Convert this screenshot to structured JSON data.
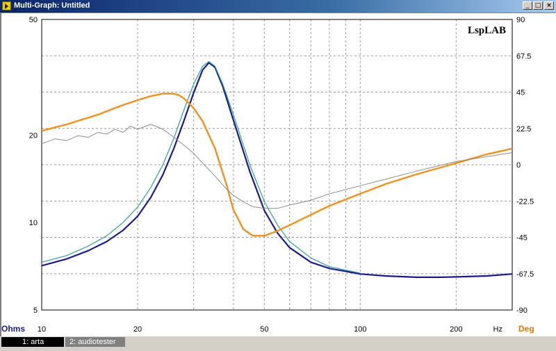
{
  "window": {
    "title": "Multi-Graph: Untitled",
    "buttons": [
      "_",
      "□",
      "×"
    ]
  },
  "watermark": "LspLAB",
  "tabs": [
    {
      "label": "1: arta",
      "active": true
    },
    {
      "label": "2: audiotester",
      "active": false
    }
  ],
  "chart_data": {
    "type": "line",
    "xlabel": "Hz",
    "ylabel_left": "Ohms",
    "ylabel_right": "Deg",
    "x_scale": "log",
    "xlim": [
      10,
      300
    ],
    "ylim_left": [
      5,
      50
    ],
    "y_left_scale": "log",
    "ylim_right": [
      -90,
      90
    ],
    "x_ticks": [
      10,
      20,
      50,
      100,
      200
    ],
    "x_tick_labels": [
      "10",
      "20",
      "50",
      "100",
      "200"
    ],
    "y_left_ticks": [
      5,
      10,
      20,
      50
    ],
    "y_left_tick_labels": [
      "5",
      "10",
      "20",
      "50"
    ],
    "y_right_ticks": [
      90,
      67.5,
      45,
      22.5,
      0,
      -22.5,
      -45,
      -67.5,
      -90
    ],
    "y_right_tick_labels": [
      "90",
      "67.5",
      "45",
      "22.5",
      "0",
      "-22.5",
      "-45",
      "-67.5",
      "-90"
    ],
    "grid": true,
    "colors": {
      "impedance_arta": "#1a1a8c",
      "impedance_audiotester": "#2aa198",
      "phase_arta": "#f0901c",
      "phase_audiotester": "#8c8c8c",
      "left_axis_label": "#1a1aa0",
      "right_axis_label": "#e07800"
    },
    "series": [
      {
        "name": "1: arta",
        "axis": "left",
        "x": [
          10,
          12,
          14,
          16,
          18,
          20,
          22,
          24,
          26,
          28,
          30,
          32,
          33.5,
          35,
          37,
          40,
          45,
          50,
          55,
          60,
          70,
          80,
          100,
          120,
          150,
          180,
          200,
          250,
          300
        ],
        "y": [
          7.1,
          7.5,
          8.0,
          8.6,
          9.4,
          10.5,
          12.2,
          14.6,
          18.0,
          22.5,
          28.0,
          33.5,
          35.5,
          34.2,
          29.5,
          22.5,
          15.0,
          11.0,
          9.2,
          8.2,
          7.3,
          6.95,
          6.65,
          6.55,
          6.48,
          6.48,
          6.5,
          6.55,
          6.65
        ]
      },
      {
        "name": "2: audiotester",
        "axis": "left",
        "x": [
          10,
          12,
          14,
          16,
          18,
          20,
          22,
          24,
          26,
          28,
          30,
          32,
          33.5,
          35,
          37,
          40,
          45,
          50,
          55,
          60,
          70,
          80,
          100
        ],
        "y": [
          7.3,
          7.7,
          8.3,
          9.0,
          10.0,
          11.3,
          13.2,
          15.8,
          19.5,
          24.5,
          30.0,
          34.5,
          35.8,
          34.5,
          30.0,
          23.5,
          15.8,
          11.8,
          9.8,
          8.6,
          7.55,
          7.05,
          6.7
        ]
      },
      {
        "name": "1: arta",
        "axis": "right",
        "x": [
          10,
          12,
          15,
          18,
          20,
          22,
          24,
          26,
          27,
          28,
          30,
          32,
          35,
          38,
          40,
          43,
          46,
          50,
          55,
          60,
          70,
          80,
          100,
          120,
          150,
          200,
          250,
          300
        ],
        "y": [
          21,
          25,
          31,
          37,
          40,
          42.5,
          44,
          44,
          43,
          41,
          35,
          27,
          10,
          -12,
          -28,
          -40,
          -44,
          -44,
          -41,
          -37.5,
          -31,
          -25.5,
          -18,
          -12,
          -6,
          1,
          6.5,
          10
        ]
      },
      {
        "name": "2: audiotester",
        "axis": "right",
        "x": [
          10,
          11,
          12,
          13,
          14,
          15,
          16,
          17,
          18,
          19,
          20,
          22,
          24,
          26,
          28,
          30,
          32,
          35,
          38,
          40,
          43,
          46,
          50,
          55,
          60,
          70,
          80,
          100,
          120,
          150,
          200,
          250,
          300
        ],
        "y": [
          13,
          16,
          15,
          18,
          17,
          20,
          19,
          22,
          20,
          24,
          22,
          25,
          22,
          17,
          12,
          7,
          1,
          -7,
          -15,
          -19,
          -23,
          -26,
          -27,
          -27,
          -25,
          -22,
          -18,
          -13,
          -9,
          -4,
          2,
          5,
          7.5
        ]
      }
    ]
  }
}
